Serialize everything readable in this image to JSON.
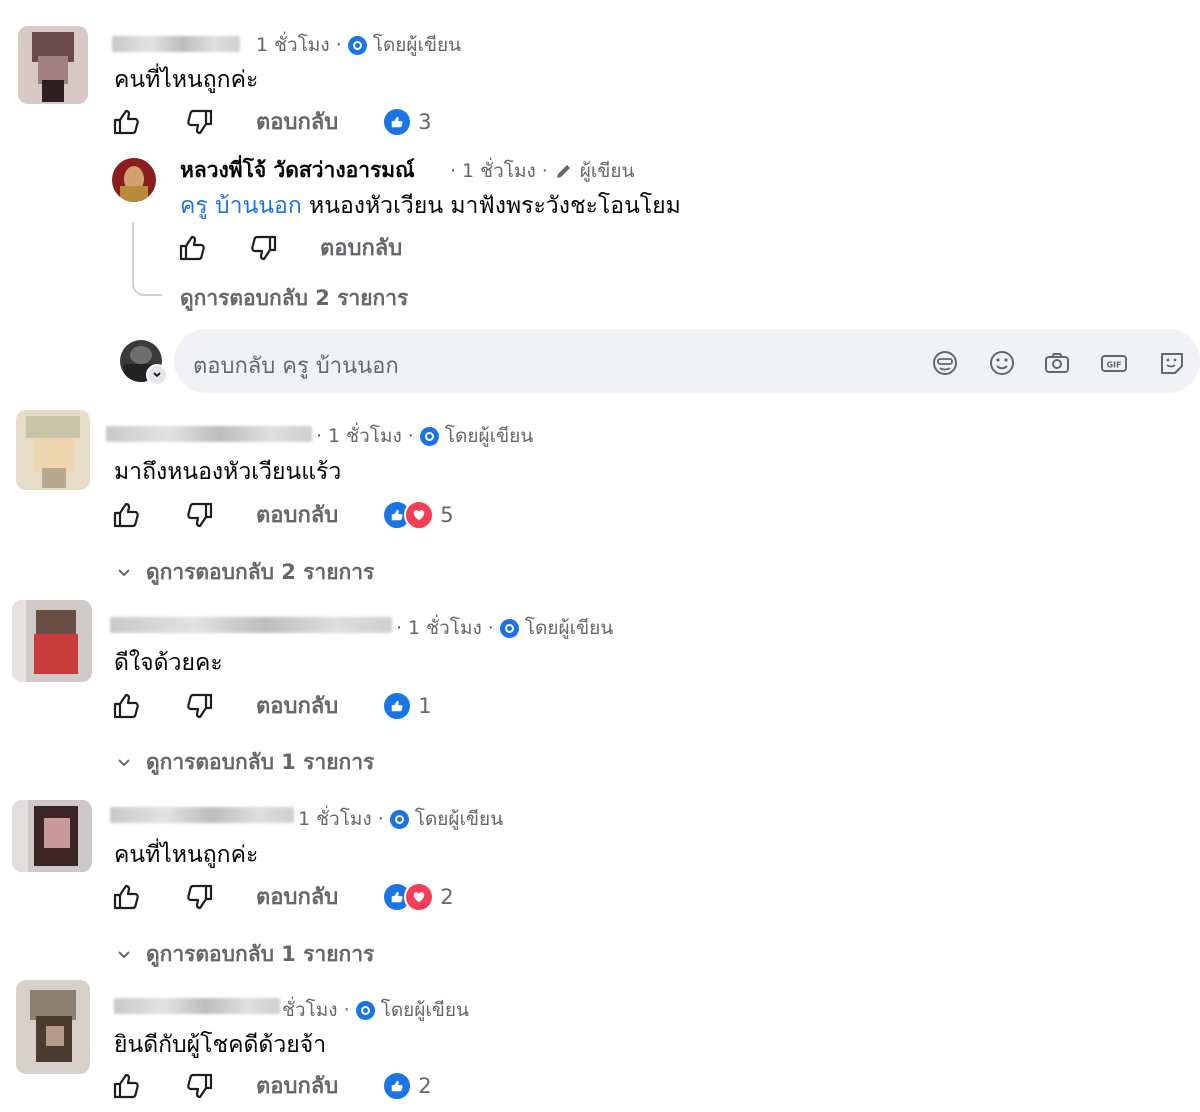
{
  "comments": [
    {
      "time": "1 ชั่วโมง",
      "badge": "โดยผู้เขียน",
      "text": "คนที่ไหนถูกค่ะ",
      "reply_label": "ตอบกลับ",
      "reaction_count": "3"
    },
    {
      "time": "1 ชั่วโมง",
      "badge": "โดยผู้เขียน",
      "text": "มาถึงหนองหัวเวียนแร้ว",
      "reply_label": "ตอบกลับ",
      "reaction_count": "5",
      "view_replies": "ดูการตอบกลับ 2 รายการ"
    },
    {
      "time": "1 ชั่วโมง",
      "badge": "โดยผู้เขียน",
      "text": "ดีใจด้วยคะ",
      "reply_label": "ตอบกลับ",
      "reaction_count": "1",
      "view_replies": "ดูการตอบกลับ 1 รายการ"
    },
    {
      "time": "1 ชั่วโมง",
      "badge": "โดยผู้เขียน",
      "text": "คนที่ไหนถูกค่ะ",
      "reply_label": "ตอบกลับ",
      "reaction_count": "2",
      "view_replies": "ดูการตอบกลับ 1 รายการ"
    },
    {
      "time": "ชั่วโมง",
      "badge": "โดยผู้เขียน",
      "text": "ยินดีกับผู้โชคดีด้วยจ้า",
      "reply_label": "ตอบกลับ",
      "reaction_count": "2"
    }
  ],
  "nested_reply": {
    "author": "หลวงพี่โจ้ วัดสว่างอารมณ์",
    "time": "1 ชั่วโมง",
    "badge": "ผู้เขียน",
    "mention": "ครู บ้านนอก",
    "text": " หนองหัวเวียน มาฟังพระวังชะโอนโยม",
    "reply_label": "ตอบกลับ",
    "view_replies": "ดูการตอบกลับ 2 รายการ"
  },
  "reply_input": {
    "placeholder": "ตอบกลับ ครู บ้านนอก",
    "icons": [
      "avatar-sticker-icon",
      "emoji-icon",
      "camera-icon",
      "gif-icon",
      "sticker-icon"
    ]
  },
  "colors": {
    "accent": "#1b74e4",
    "heart": "#f33e58",
    "secondary_text": "#65676b",
    "input_bg": "#f0f2f5"
  }
}
